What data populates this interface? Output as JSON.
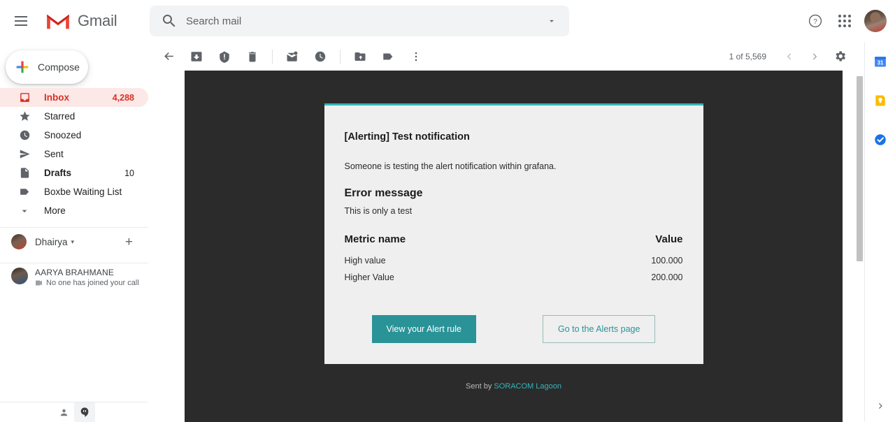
{
  "header": {
    "menu_label": "Main menu",
    "brand": "Gmail",
    "search": {
      "placeholder": "Search mail",
      "value": "",
      "icon": "search-icon",
      "options_icon": "chevron-down-icon"
    },
    "help_icon": "help-icon",
    "apps_icon": "apps-grid-icon",
    "avatar_icon": "user-avatar"
  },
  "sidebar": {
    "compose_label": "Compose",
    "items": [
      {
        "label": "Inbox",
        "count": "4,288",
        "icon": "inbox-icon",
        "active": true
      },
      {
        "label": "Starred",
        "count": "",
        "icon": "star-icon",
        "active": false
      },
      {
        "label": "Snoozed",
        "count": "",
        "icon": "clock-icon",
        "active": false
      },
      {
        "label": "Sent",
        "count": "",
        "icon": "send-icon",
        "active": false
      },
      {
        "label": "Drafts",
        "count": "10",
        "icon": "draft-icon",
        "active": false
      },
      {
        "label": "Boxbe Waiting List",
        "count": "",
        "icon": "label-icon",
        "active": false
      },
      {
        "label": "More",
        "count": "",
        "icon": "chevron-down-icon",
        "active": false
      }
    ],
    "account": {
      "name": "Dhairya",
      "caret": "▾",
      "add_label": "+"
    },
    "contact": {
      "name": "AARYA BRAHMANE",
      "status": "No one has joined your call",
      "status_icon": "video-camera-icon"
    },
    "footer": {
      "contacts_icon": "person-icon",
      "hangouts_icon": "hangouts-icon"
    }
  },
  "toolbar": {
    "back_label": "Back to Inbox",
    "buttons": [
      {
        "name": "archive-icon"
      },
      {
        "name": "report-spam-icon"
      },
      {
        "name": "delete-icon"
      },
      {
        "name": "mark-unread-icon"
      },
      {
        "name": "snooze-icon"
      },
      {
        "name": "move-to-icon"
      },
      {
        "name": "labels-icon"
      },
      {
        "name": "more-options-icon"
      }
    ],
    "pagination": "1 of 5,569",
    "prev_label": "Older",
    "next_label": "Newer",
    "settings_icon": "gear-icon"
  },
  "email": {
    "card": {
      "title": "[Alerting] Test notification",
      "lead": "Someone is testing the alert notification within grafana.",
      "error_heading": "Error message",
      "error_text": "This is only a test",
      "table": {
        "headers": [
          "Metric name",
          "Value"
        ],
        "rows": [
          [
            "High value",
            "100.000"
          ],
          [
            "Higher Value",
            "200.000"
          ]
        ]
      },
      "primary_button": "View your Alert rule",
      "secondary_button": "Go to the Alerts page"
    },
    "footer": {
      "prefix": "Sent by ",
      "link": "SORACOM Lagoon"
    }
  },
  "rail": {
    "items": [
      {
        "name": "google-calendar-icon",
        "label": "31"
      },
      {
        "name": "google-keep-icon",
        "label": ""
      },
      {
        "name": "google-tasks-icon",
        "label": ""
      }
    ],
    "expand_icon": "chevron-right-icon"
  },
  "colors": {
    "gmail_red": "#d93025",
    "inbox_highlight": "#fce8e6",
    "grafana_teal": "#2a9398",
    "accent_bar": "#33b5bb",
    "mail_dark_bg": "#2b2b2b",
    "card_bg": "#efefef"
  }
}
